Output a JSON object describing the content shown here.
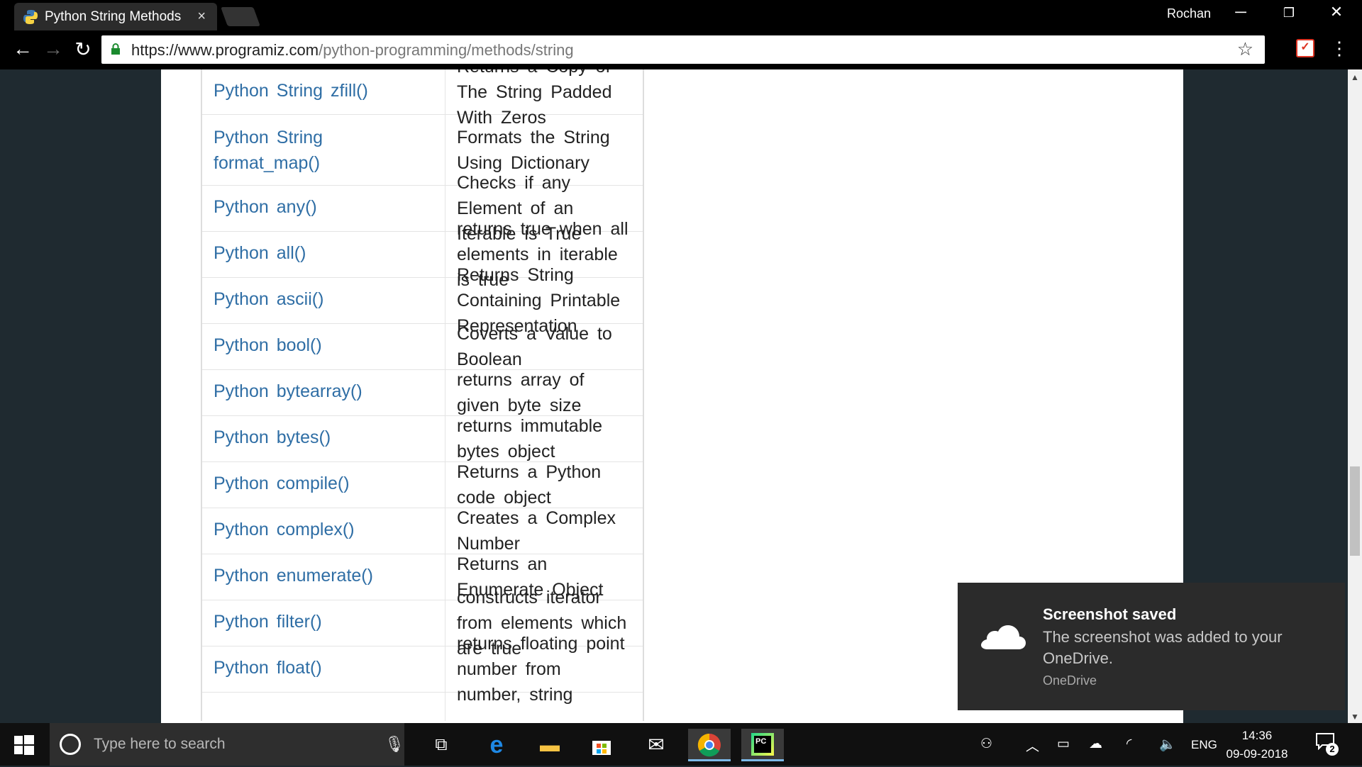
{
  "browser": {
    "tab_title": "Python String Methods",
    "tab_close": "×",
    "user": "Rochan",
    "controls": {
      "minimize": "─",
      "restore": "❐",
      "close": "✕"
    },
    "nav": {
      "back": "←",
      "forward": "→",
      "reload": "↻"
    },
    "url_host": "https://www.programiz.com",
    "url_path": "/python-programming/methods/string",
    "bookmark_star": "☆",
    "menu": "⋮"
  },
  "table": {
    "rows": [
      {
        "name": "Python String zfill()",
        "desc": "Returns a Copy of The String Padded With Zeros"
      },
      {
        "name": "Python String format_map()",
        "desc": "Formats the String Using Dictionary"
      },
      {
        "name": "Python any()",
        "desc": "Checks if any Element of an Iterable is True"
      },
      {
        "name": "Python all()",
        "desc": "returns true when all elements in iterable is true"
      },
      {
        "name": "Python ascii()",
        "desc": "Returns String Containing Printable Representation"
      },
      {
        "name": "Python bool()",
        "desc": "Coverts a Value to Boolean"
      },
      {
        "name": "Python bytearray()",
        "desc": "returns array of given byte size"
      },
      {
        "name": "Python bytes()",
        "desc": "returns immutable bytes object"
      },
      {
        "name": "Python compile()",
        "desc": "Returns a Python code object"
      },
      {
        "name": "Python complex()",
        "desc": "Creates a Complex Number"
      },
      {
        "name": "Python enumerate()",
        "desc": "Returns an Enumerate Object"
      },
      {
        "name": "Python filter()",
        "desc": "constructs iterator from elements which are true"
      },
      {
        "name": "Python float()",
        "desc": "returns floating point number from number, string"
      }
    ]
  },
  "toast": {
    "title": "Screenshot saved",
    "body": "The screenshot was added to your OneDrive.",
    "source": "OneDrive"
  },
  "taskbar": {
    "search_placeholder": "Type here to search",
    "language": "ENG",
    "time": "14:36",
    "date": "09-09-2018",
    "notification_count": "2"
  },
  "colors": {
    "link": "#2f6ea5",
    "toast_bg": "#2b2b2b",
    "taskbar_bg": "#101010"
  }
}
